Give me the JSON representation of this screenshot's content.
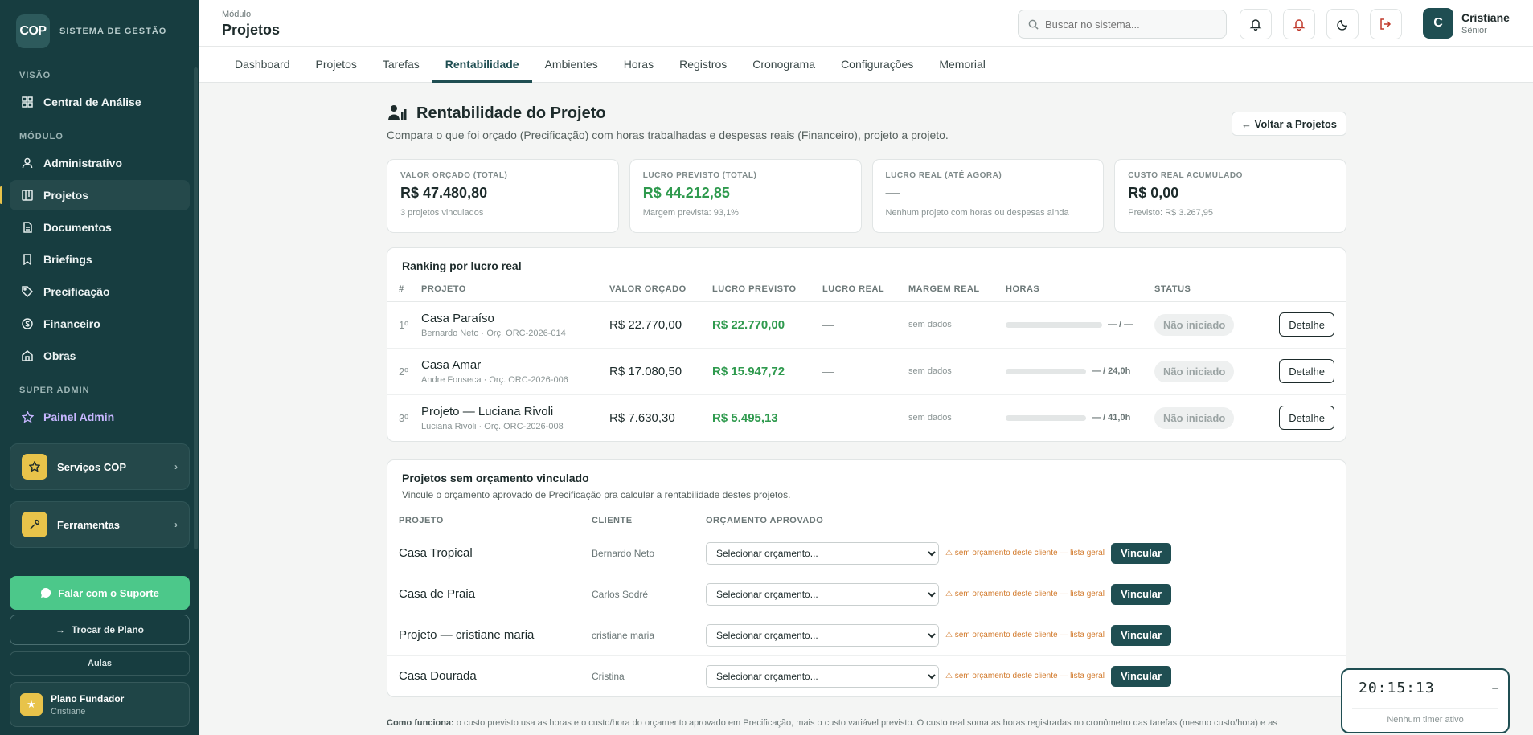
{
  "app": {
    "logo": "COP",
    "brand": "SISTEMA DE GESTÃO"
  },
  "sidebar": {
    "sections": {
      "visao": "VISÃO",
      "modulo": "MÓDULO",
      "super_admin": "SUPER ADMIN"
    },
    "items": [
      {
        "label": "Central de Análise",
        "icon": "grid-icon"
      },
      {
        "label": "Administrativo",
        "icon": "user-icon"
      },
      {
        "label": "Projetos",
        "icon": "kanban-icon",
        "active": true
      },
      {
        "label": "Documentos",
        "icon": "document-icon"
      },
      {
        "label": "Briefings",
        "icon": "bookmark-icon"
      },
      {
        "label": "Precificação",
        "icon": "tag-icon"
      },
      {
        "label": "Financeiro",
        "icon": "dollar-icon"
      },
      {
        "label": "Obras",
        "icon": "home-icon"
      },
      {
        "label": "Painel Admin",
        "icon": "star-icon"
      }
    ],
    "tools": [
      {
        "label": "Serviços COP",
        "icon": "star-icon"
      },
      {
        "label": "Ferramentas",
        "icon": "wrench-icon"
      }
    ],
    "support_label": "Falar com o Suporte",
    "change_plan_label": "Trocar de Plano",
    "aulas_label": "Aulas",
    "plan": {
      "name": "Plano Fundador",
      "user": "Cristiane"
    }
  },
  "topbar": {
    "module_label": "Módulo",
    "module_title": "Projetos",
    "search_placeholder": "Buscar no sistema...",
    "user": {
      "initial": "C",
      "name": "Cristiane",
      "role": "Sênior"
    }
  },
  "tabs": [
    "Dashboard",
    "Projetos",
    "Tarefas",
    "Rentabilidade",
    "Ambientes",
    "Horas",
    "Registros",
    "Cronograma",
    "Configurações",
    "Memorial"
  ],
  "active_tab": "Rentabilidade",
  "page": {
    "title": "Rentabilidade do Projeto",
    "subtitle": "Compara o que foi orçado (Precificação) com horas trabalhadas e despesas reais (Financeiro), projeto a projeto.",
    "back_label": "← Voltar a Projetos"
  },
  "kpis": [
    {
      "label": "VALOR ORÇADO (TOTAL)",
      "value": "R$ 47.480,80",
      "note": "3 projetos vinculados",
      "tone": "normal"
    },
    {
      "label": "LUCRO PREVISTO (TOTAL)",
      "value": "R$ 44.212,85",
      "note": "Margem prevista: 93,1%",
      "tone": "green"
    },
    {
      "label": "LUCRO REAL (ATÉ AGORA)",
      "value": "—",
      "note": "Nenhum projeto com horas ou despesas ainda",
      "tone": "dash"
    },
    {
      "label": "CUSTO REAL ACUMULADO",
      "value": "R$ 0,00",
      "note": "Previsto: R$ 3.267,95",
      "tone": "normal"
    }
  ],
  "ranking": {
    "title": "Ranking por lucro real",
    "headers": [
      "#",
      "PROJETO",
      "VALOR ORÇADO",
      "LUCRO PREVISTO",
      "LUCRO REAL",
      "MARGEM REAL",
      "HORAS",
      "STATUS"
    ],
    "rows": [
      {
        "rank": "1º",
        "name": "Casa Paraíso",
        "meta": "Bernardo Neto · Orç. ORC-2026-014",
        "budget": "R$ 22.770,00",
        "profit": "R$ 22.770,00",
        "real": "—",
        "margin": "sem dados",
        "hours": "— / —",
        "status": "Não iniciado",
        "action": "Detalhe"
      },
      {
        "rank": "2º",
        "name": "Casa Amar",
        "meta": "Andre Fonseca · Orç. ORC-2026-006",
        "budget": "R$ 17.080,50",
        "profit": "R$ 15.947,72",
        "real": "—",
        "margin": "sem dados",
        "hours": "— / 24,0h",
        "status": "Não iniciado",
        "action": "Detalhe"
      },
      {
        "rank": "3º",
        "name": "Projeto — Luciana Rivoli",
        "meta": "Luciana Rivoli · Orç. ORC-2026-008",
        "budget": "R$ 7.630,30",
        "profit": "R$ 5.495,13",
        "real": "—",
        "margin": "sem dados",
        "hours": "— / 41,0h",
        "status": "Não iniciado",
        "action": "Detalhe"
      }
    ]
  },
  "unlinked": {
    "title": "Projetos sem orçamento vinculado",
    "subtitle": "Vincule o orçamento aprovado de Precificação pra calcular a rentabilidade destes projetos.",
    "headers": [
      "PROJETO",
      "CLIENTE",
      "ORÇAMENTO APROVADO"
    ],
    "select_placeholder": "Selecionar orçamento...",
    "warning": "⚠ sem orçamento deste cliente — lista geral",
    "button": "Vincular",
    "rows": [
      {
        "name": "Casa Tropical",
        "client": "Bernardo Neto"
      },
      {
        "name": "Casa de Praia",
        "client": "Carlos Sodré"
      },
      {
        "name": "Projeto — cristiane maria",
        "client": "cristiane maria"
      },
      {
        "name": "Casa Dourada",
        "client": "Cristina"
      }
    ]
  },
  "footnote": {
    "label": "Como funciona:",
    "text": " o custo previsto usa as horas e o custo/hora do orçamento aprovado em Precificação, mais o custo variável previsto. O custo real soma as horas registradas no cronômetro das tarefas (mesmo custo/hora) e as"
  },
  "timer": {
    "time": "20:15:13",
    "note": "Nenhum timer ativo",
    "minimize": "–"
  }
}
